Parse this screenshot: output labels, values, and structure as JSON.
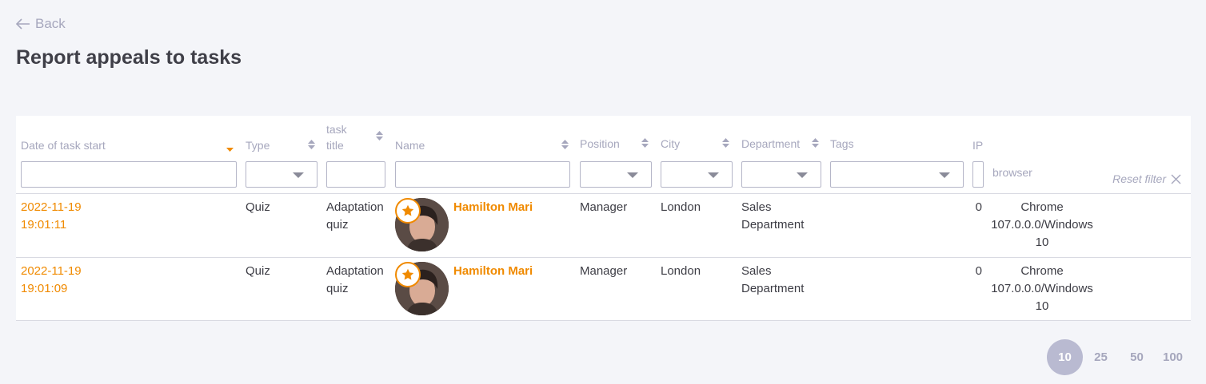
{
  "nav": {
    "back_label": "Back"
  },
  "page": {
    "title": "Report appeals to tasks"
  },
  "table": {
    "columns": {
      "date": "Date of task start",
      "type": "Type",
      "task_title_1": "task",
      "task_title_2": "title",
      "name": "Name",
      "position": "Position",
      "city": "City",
      "department": "Department",
      "tags": "Tags",
      "ip": "IP",
      "browser": "browser"
    },
    "reset_filter": "Reset filter",
    "rows": [
      {
        "date": "2022-11-19",
        "time": "19:01:11",
        "type": "Quiz",
        "task_title_1": "Adaptation",
        "task_title_2": "quiz",
        "name": "Hamilton Mari",
        "position": "Manager",
        "city": "London",
        "department_1": "Sales",
        "department_2": "Department",
        "ip": "0",
        "browser_1": "Chrome",
        "browser_2": "107.0.0.0/Windows",
        "browser_3": "10"
      },
      {
        "date": "2022-11-19",
        "time": "19:01:09",
        "type": "Quiz",
        "task_title_1": "Adaptation",
        "task_title_2": "quiz",
        "name": "Hamilton Mari",
        "position": "Manager",
        "city": "London",
        "department_1": "Sales",
        "department_2": "Department",
        "ip": "0",
        "browser_1": "Chrome",
        "browser_2": "107.0.0.0/Windows",
        "browser_3": "10"
      }
    ]
  },
  "pagination": {
    "sizes": [
      "10",
      "25",
      "50",
      "100"
    ],
    "active": "10"
  },
  "colors": {
    "accent": "#f08a00",
    "muted": "#a6a7bd",
    "background": "#f4f5f9"
  },
  "icons": {
    "back": "arrow-left-icon",
    "sort": "sort-icon",
    "reset": "close-icon",
    "badge": "star-icon"
  }
}
